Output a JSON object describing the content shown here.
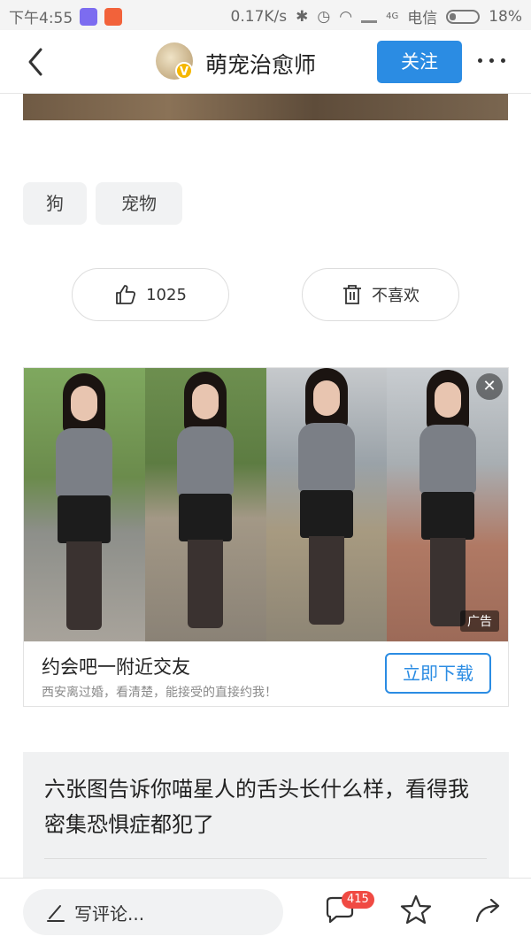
{
  "status_bar": {
    "time": "下午4:55",
    "speed": "0.17K/s",
    "network_label": "4G",
    "carrier": "电信",
    "battery": "18%"
  },
  "nav": {
    "back_icon": "back-chevron-icon",
    "verified_badge": "V",
    "title": "萌宠治愈师",
    "follow_label": "关注",
    "more_icon": "more-dots-icon"
  },
  "tags": [
    "狗",
    "宠物"
  ],
  "actions": {
    "like_icon": "thumbs-up-icon",
    "like_count": "1025",
    "dislike_icon": "trash-icon",
    "dislike_label": "不喜欢"
  },
  "ad": {
    "close_label": "✕",
    "badge": "广告",
    "title": "约会吧一附近交友",
    "description": "西安离过婚，看清楚，能接受的直接约我！",
    "cta": "立即下载"
  },
  "related": {
    "title": "六张图告诉你喵星人的舌头长什么样，看得我密集恐惧症都犯了"
  },
  "bottom_bar": {
    "comment_placeholder": "写评论...",
    "comment_count": "415",
    "comment_icon": "comment-bubble-icon",
    "favorite_icon": "star-icon",
    "share_icon": "share-arrow-icon"
  },
  "colors": {
    "accent": "#2b8ce3",
    "badge_red": "#f04a43",
    "tag_bg": "#f1f2f3"
  }
}
